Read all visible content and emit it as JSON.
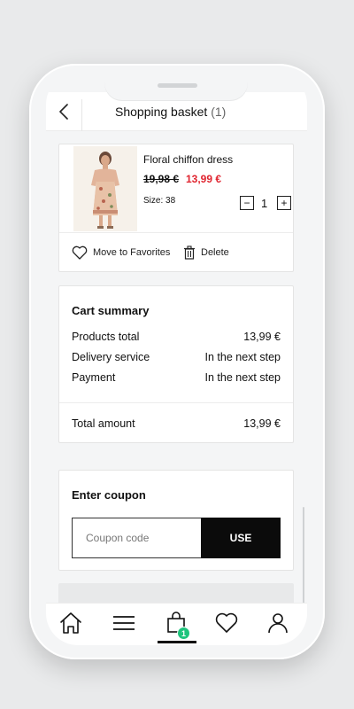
{
  "header": {
    "title": "Shopping basket",
    "count": "(1)"
  },
  "product": {
    "name": "Floral chiffon dress",
    "price_old": "19,98 €",
    "price_new": "13,99 €",
    "size": "Size: 38",
    "quantity": "1",
    "minus": "−",
    "plus": "+",
    "favorites_label": "Move to Favorites",
    "delete_label": "Delete"
  },
  "summary": {
    "title": "Cart summary",
    "rows": [
      {
        "label": "Products total",
        "value": "13,99 €"
      },
      {
        "label": "Delivery service",
        "value": "In the next step"
      },
      {
        "label": "Payment",
        "value": "In the next step"
      }
    ],
    "total_label": "Total amount",
    "total_value": "13,99 €"
  },
  "coupon": {
    "title": "Enter coupon",
    "placeholder": "Coupon code",
    "button": "USE"
  },
  "nav": {
    "items": [
      "home-icon",
      "menu-icon",
      "shopping-bag-icon",
      "heart-icon",
      "user-icon"
    ],
    "active": "shopping-bag-icon",
    "bag_badge": "1"
  },
  "colors": {
    "sale_price": "#e0242f",
    "badge": "#1fc47d",
    "button_bg": "#0b0b0b"
  }
}
